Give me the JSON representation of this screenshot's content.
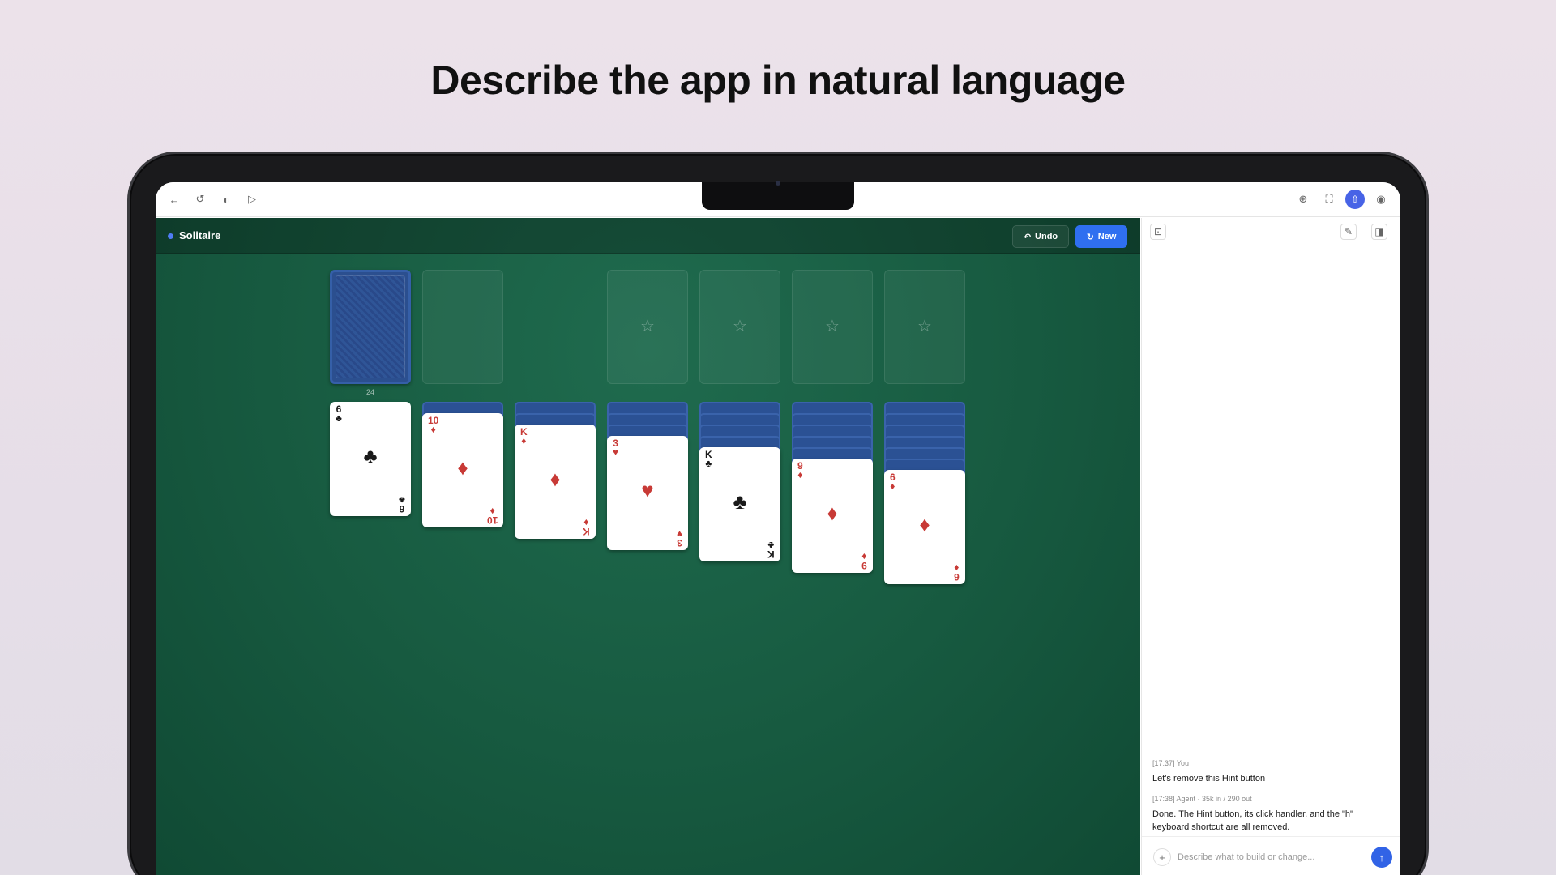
{
  "headline": "Describe the app in natural language",
  "browser": {
    "icons": [
      "back-arrow-icon",
      "history-icon",
      "contrast-icon",
      "send-icon",
      "zoom-icon",
      "fullscreen-icon",
      "share-icon",
      "profile-icon"
    ]
  },
  "app": {
    "title": "Solitaire",
    "accent": "#2f6ff0",
    "buttons": {
      "undo": "Undo",
      "new": "New"
    },
    "stock_count": "24",
    "foundation_symbol": "☆",
    "tableau": [
      {
        "rank": "6",
        "suit": "♣",
        "color": "black",
        "face_down": 0
      },
      {
        "rank": "10",
        "suit": "♦",
        "color": "red",
        "face_down": 1
      },
      {
        "rank": "K",
        "suit": "♦",
        "color": "red",
        "face_down": 2
      },
      {
        "rank": "3",
        "suit": "♥",
        "color": "red",
        "face_down": 3
      },
      {
        "rank": "K",
        "suit": "♣",
        "color": "black",
        "face_down": 4
      },
      {
        "rank": "9",
        "suit": "♦",
        "color": "red",
        "face_down": 5
      },
      {
        "rank": "6",
        "suit": "♦",
        "color": "red",
        "face_down": 6
      }
    ]
  },
  "chat": {
    "messages": [
      {
        "meta": "[17:37] You",
        "text": "Let's remove this Hint button"
      },
      {
        "meta": "[17:38] Agent · 35k in / 290 out",
        "text": "Done. The Hint button, its click handler, and the \"h\" keyboard shortcut are all removed."
      }
    ],
    "input_placeholder": "Describe what to build or change..."
  }
}
